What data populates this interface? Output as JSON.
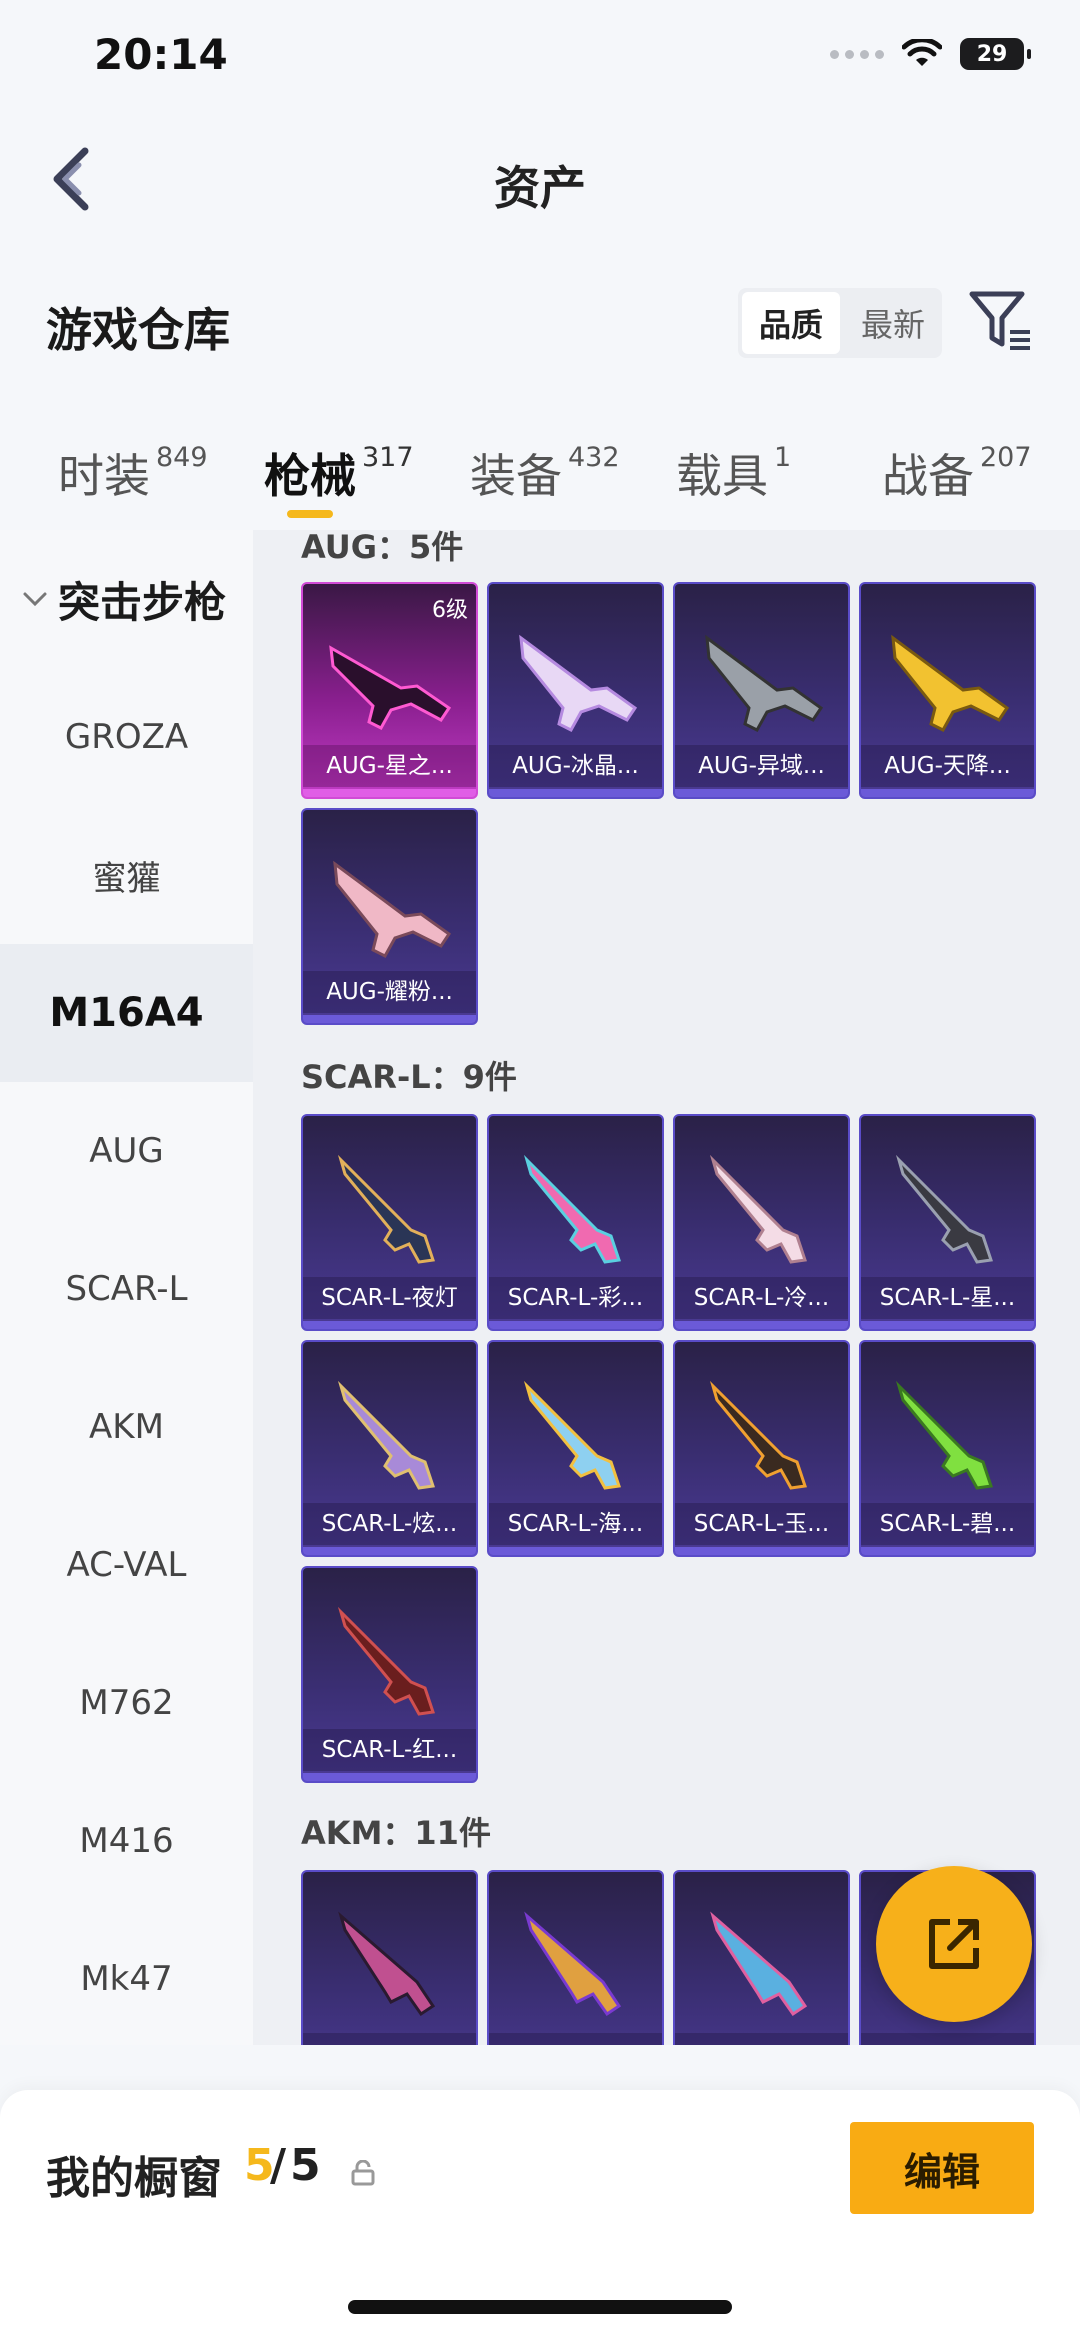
{
  "status_bar": {
    "time": "20:14",
    "battery": "29"
  },
  "nav": {
    "title": "资产"
  },
  "warehouse": {
    "title": "游戏仓库",
    "sort_options": [
      "品质",
      "最新"
    ],
    "active_sort": "品质"
  },
  "tabs": [
    {
      "label": "时装",
      "count": "849"
    },
    {
      "label": "枪械",
      "count": "317",
      "active": true
    },
    {
      "label": "装备",
      "count": "432"
    },
    {
      "label": "载具",
      "count": "1"
    },
    {
      "label": "战备",
      "count": "207"
    }
  ],
  "sidebar": {
    "group": "突击步枪",
    "items": [
      "GROZA",
      "蜜獾",
      "M16A4",
      "AUG",
      "SCAR-L",
      "AKM",
      "AC-VAL",
      "M762",
      "M416",
      "Mk47"
    ],
    "selected": "M16A4"
  },
  "sections": [
    {
      "title": "AUG：5件",
      "cards": [
        {
          "label": "AUG-星之...",
          "level": "6级",
          "rarity": "pink"
        },
        {
          "label": "AUG-冰晶...",
          "rarity": "purple"
        },
        {
          "label": "AUG-异域...",
          "rarity": "purple"
        },
        {
          "label": "AUG-天降...",
          "rarity": "purple"
        },
        {
          "label": "AUG-耀粉...",
          "rarity": "purple"
        }
      ]
    },
    {
      "title": "SCAR-L：9件",
      "cards": [
        {
          "label": "SCAR-L-夜灯",
          "rarity": "purple"
        },
        {
          "label": "SCAR-L-彩...",
          "rarity": "purple"
        },
        {
          "label": "SCAR-L-冷...",
          "rarity": "purple"
        },
        {
          "label": "SCAR-L-星...",
          "rarity": "purple"
        },
        {
          "label": "SCAR-L-炫...",
          "rarity": "purple"
        },
        {
          "label": "SCAR-L-海...",
          "rarity": "purple"
        },
        {
          "label": "SCAR-L-玉...",
          "rarity": "purple"
        },
        {
          "label": "SCAR-L-碧...",
          "rarity": "purple"
        },
        {
          "label": "SCAR-L-红...",
          "rarity": "purple"
        }
      ]
    },
    {
      "title": "AKM：11件",
      "cards": [
        {
          "label": "",
          "rarity": "purple"
        },
        {
          "label": "",
          "rarity": "purple"
        },
        {
          "label": "",
          "rarity": "purple"
        },
        {
          "label": "",
          "rarity": "purple"
        }
      ]
    }
  ],
  "showcase": {
    "label": "我的橱窗",
    "count": "5",
    "slash": "/",
    "max": "5",
    "edit_label": "编辑"
  },
  "colors": {
    "accent": "#f5b81c",
    "edit_button": "#f9ab13",
    "card_purple": "#4b3a94",
    "card_pink": "#c23cc6"
  },
  "icons": {
    "back": "chevron-left-icon",
    "filter": "filter-icon",
    "share": "share-external-icon",
    "lock": "lock-icon",
    "wifi": "wifi-icon",
    "battery": "battery-icon"
  }
}
